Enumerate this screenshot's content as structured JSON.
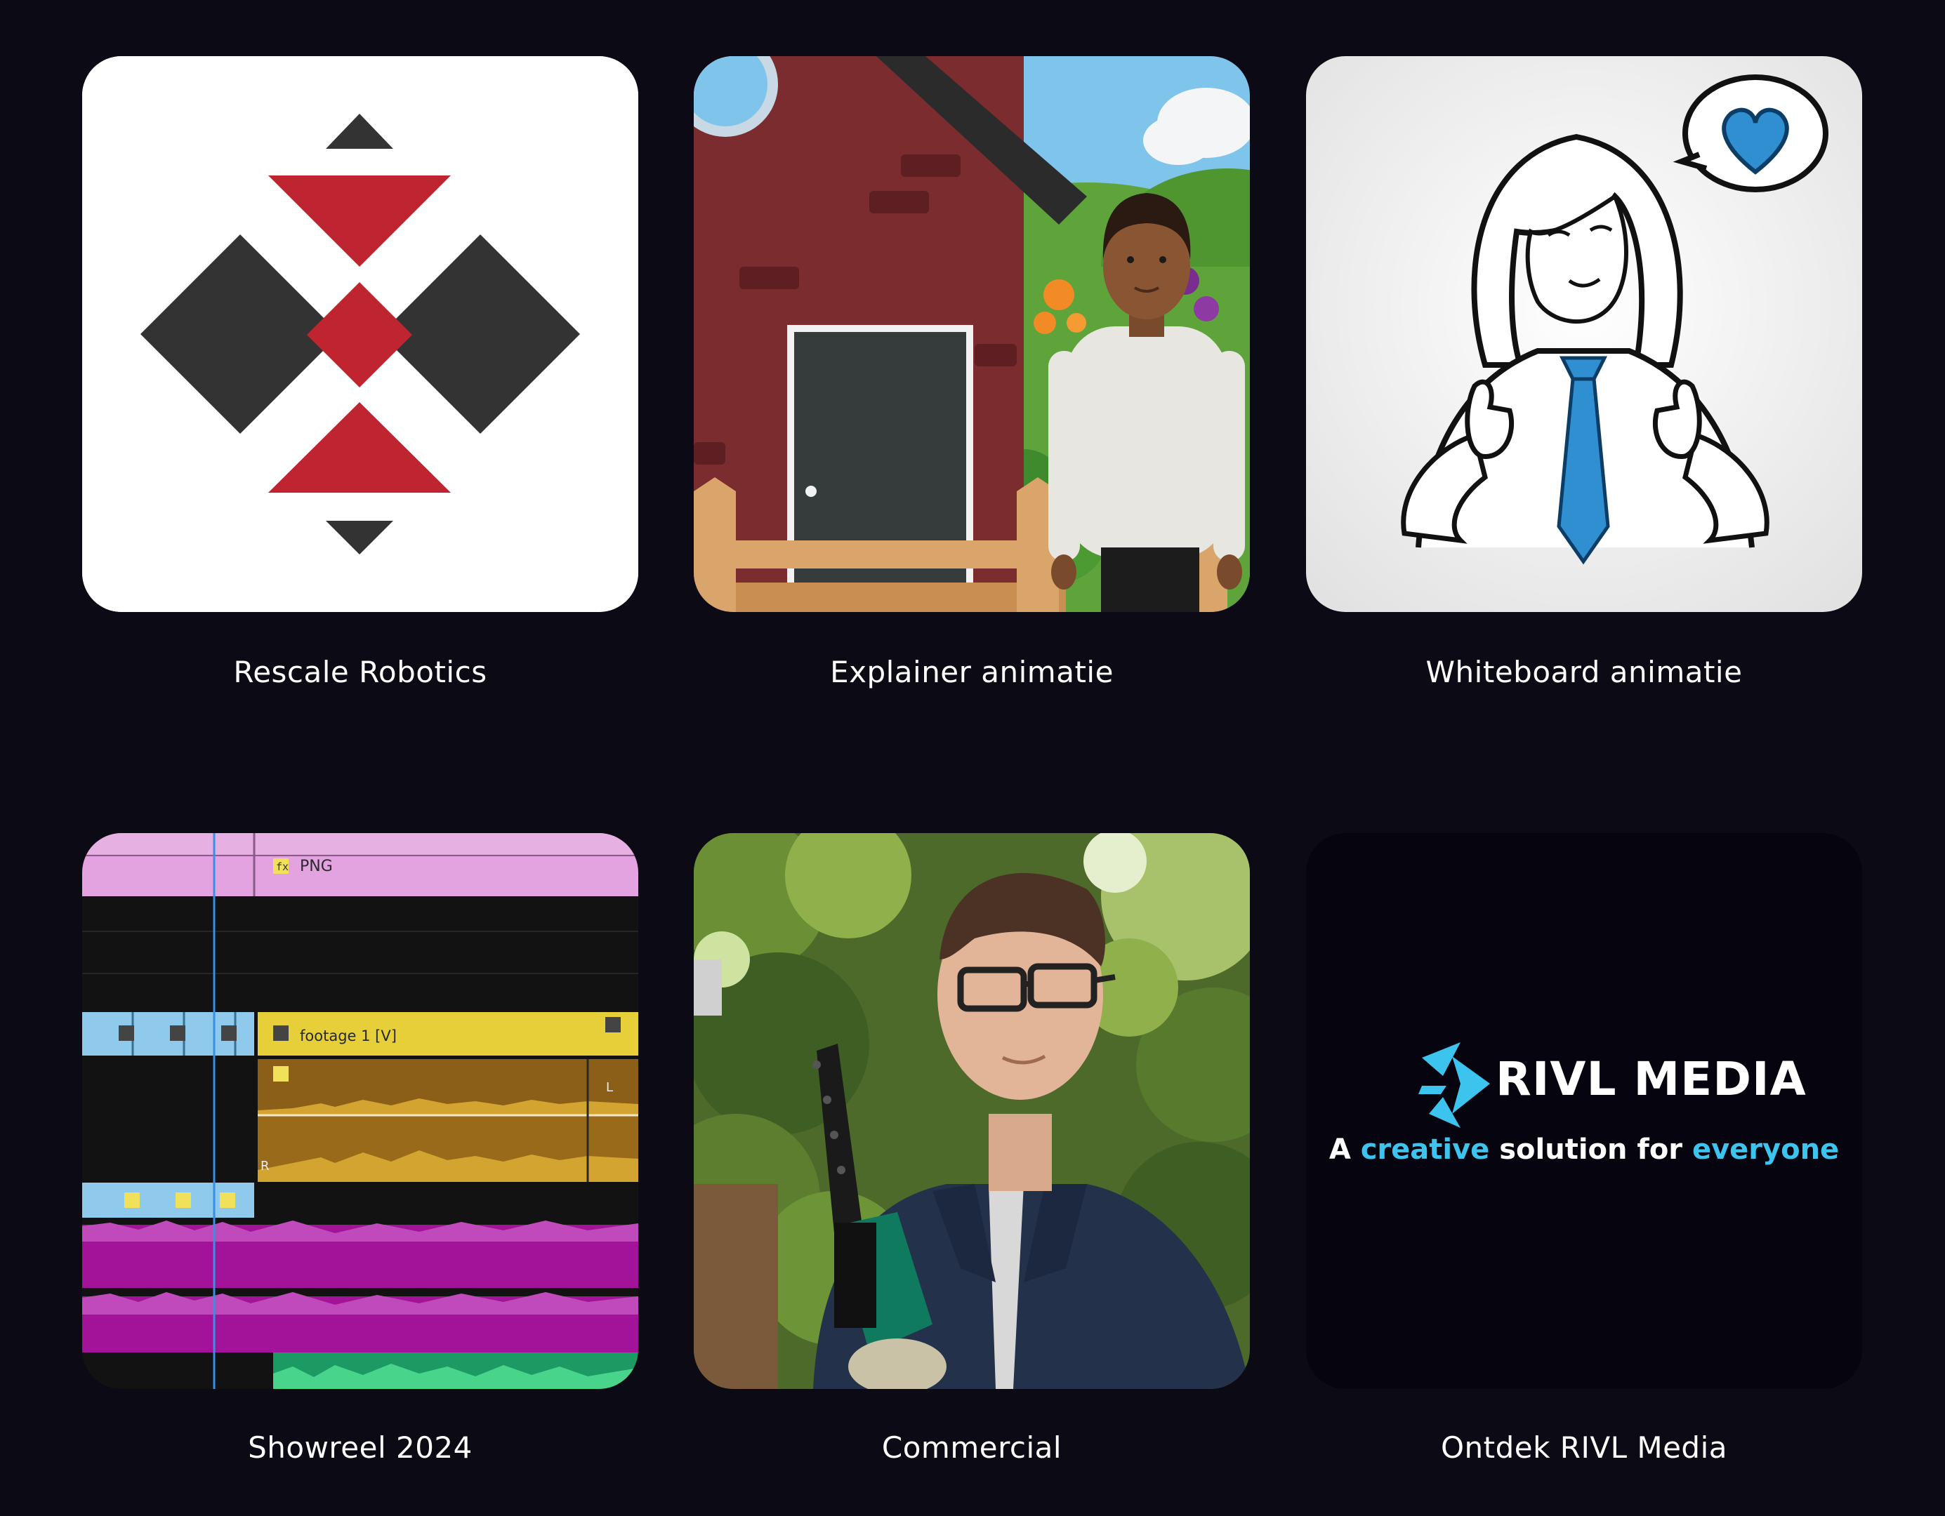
{
  "portfolio": {
    "items": [
      {
        "caption": "Rescale Robotics",
        "thumbnail": "rescale-robotics-logo"
      },
      {
        "caption": "Explainer animatie",
        "thumbnail": "animated-house-and-man"
      },
      {
        "caption": "Whiteboard animatie",
        "thumbnail": "whiteboard-girl-with-heart"
      },
      {
        "caption": "Showreel 2024",
        "thumbnail": "video-editing-timeline"
      },
      {
        "caption": "Commercial",
        "thumbnail": "man-with-hedge-trimmer"
      },
      {
        "caption": "Ontdek RIVL Media",
        "thumbnail": "rivl-media-logo"
      }
    ]
  },
  "timeline": {
    "clip_png": "PNG",
    "clip_footage": "footage 1 [V]",
    "fx_badge": "fx",
    "marker_l": "L",
    "marker_r": "R"
  },
  "rivl": {
    "brand": "RIVL MEDIA",
    "tagline_a": "A ",
    "tagline_creative": "creative",
    "tagline_mid": " solution for ",
    "tagline_everyone": "everyone"
  },
  "colors": {
    "background": "#0c0a14",
    "caption_text": "#ffffff",
    "rescale_red": "#bf2530",
    "rescale_dark": "#333333",
    "rivl_accent": "#3cc4ef",
    "rivl_bg": "#05040f"
  }
}
